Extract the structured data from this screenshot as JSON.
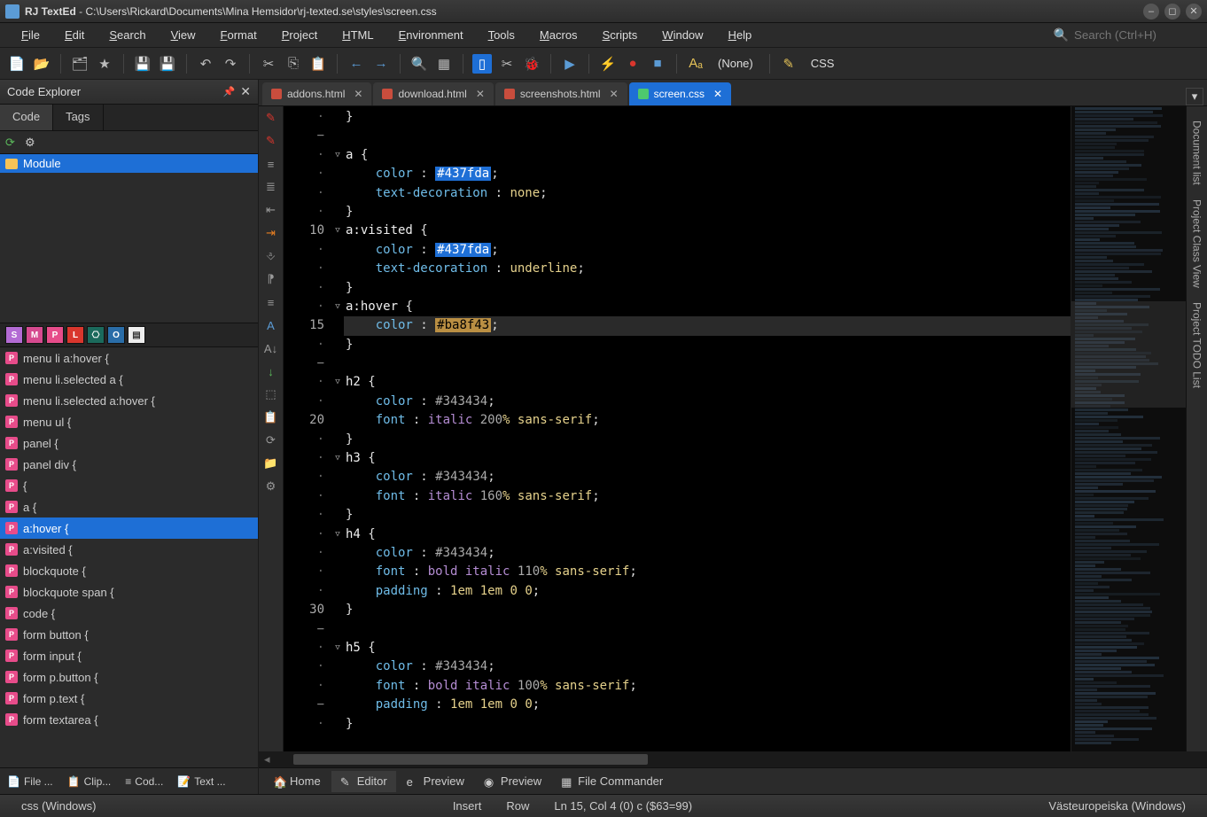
{
  "window": {
    "app_name": "RJ TextEd",
    "path": "C:\\Users\\Rickard\\Documents\\Mina Hemsidor\\rj-texted.se\\styles\\screen.css"
  },
  "menu": [
    "File",
    "Edit",
    "Search",
    "View",
    "Format",
    "Project",
    "HTML",
    "Environment",
    "Tools",
    "Macros",
    "Scripts",
    "Window",
    "Help"
  ],
  "search_placeholder": "Search (Ctrl+H)",
  "toolbar": {
    "scheme_label": "(None)",
    "lang_label": "CSS"
  },
  "explorer": {
    "title": "Code Explorer",
    "tabs": [
      "Code",
      "Tags"
    ],
    "active_tab": 0,
    "tree_item": "Module",
    "filters": [
      "S",
      "M",
      "P",
      "L",
      "⎔",
      "O",
      "▤"
    ],
    "list": [
      "menu li a:hover {",
      "menu li.selected a {",
      "menu li.selected a:hover {",
      "menu ul {",
      "panel {",
      "panel div {",
      "{",
      "a {",
      "a:hover {",
      "a:visited {",
      "blockquote {",
      "blockquote span {",
      "code {",
      "form button {",
      "form input {",
      "form p.button {",
      "form p.text {",
      "form textarea {"
    ],
    "selected_list": 8
  },
  "left_bottom_tabs": [
    "File ...",
    "Clip...",
    "Cod...",
    "Text ..."
  ],
  "doc_tabs": [
    {
      "label": "addons.html",
      "active": false
    },
    {
      "label": "download.html",
      "active": false
    },
    {
      "label": "screenshots.html",
      "active": false
    },
    {
      "label": "screen.css",
      "active": true
    }
  ],
  "code_lines": [
    {
      "g": "·",
      "f": "",
      "t": [
        [
          "brace",
          "}"
        ]
      ]
    },
    {
      "g": "−",
      "f": "",
      "t": []
    },
    {
      "g": "·",
      "f": "tri",
      "t": [
        [
          "sel",
          "a "
        ],
        [
          "brace",
          "{"
        ]
      ]
    },
    {
      "g": "·",
      "f": "",
      "t": [
        [
          "pad",
          "    "
        ],
        [
          "prop",
          "color"
        ],
        [
          "colon",
          " : "
        ],
        [
          "hex",
          "#437fda"
        ],
        [
          "semi",
          ";"
        ]
      ]
    },
    {
      "g": "·",
      "f": "",
      "t": [
        [
          "pad",
          "    "
        ],
        [
          "prop",
          "text-decoration"
        ],
        [
          "colon",
          " : "
        ],
        [
          "val",
          "none"
        ],
        [
          "semi",
          ";"
        ]
      ]
    },
    {
      "g": "·",
      "f": "",
      "t": [
        [
          "brace",
          "}"
        ]
      ]
    },
    {
      "g": "10",
      "f": "tri",
      "t": [
        [
          "sel",
          "a:visited "
        ],
        [
          "brace",
          "{"
        ]
      ]
    },
    {
      "g": "·",
      "f": "",
      "t": [
        [
          "pad",
          "    "
        ],
        [
          "prop",
          "color"
        ],
        [
          "colon",
          " : "
        ],
        [
          "hex",
          "#437fda"
        ],
        [
          "semi",
          ";"
        ]
      ]
    },
    {
      "g": "·",
      "f": "",
      "t": [
        [
          "pad",
          "    "
        ],
        [
          "prop",
          "text-decoration"
        ],
        [
          "colon",
          " : "
        ],
        [
          "val",
          "underline"
        ],
        [
          "semi",
          ";"
        ]
      ]
    },
    {
      "g": "·",
      "f": "",
      "t": [
        [
          "brace",
          "}"
        ]
      ]
    },
    {
      "g": "·",
      "f": "tri",
      "t": [
        [
          "sel",
          "a:hover "
        ],
        [
          "brace",
          "{"
        ]
      ]
    },
    {
      "g": "15",
      "f": "",
      "hl": true,
      "t": [
        [
          "pad",
          "    "
        ],
        [
          "prop",
          "color"
        ],
        [
          "colon",
          " : "
        ],
        [
          "hex2",
          "#ba8f43"
        ],
        [
          "semi",
          ";"
        ]
      ]
    },
    {
      "g": "·",
      "f": "",
      "t": [
        [
          "brace",
          "}"
        ]
      ]
    },
    {
      "g": "−",
      "f": "",
      "t": []
    },
    {
      "g": "·",
      "f": "tri",
      "t": [
        [
          "sel",
          "h2 "
        ],
        [
          "brace",
          "{"
        ]
      ]
    },
    {
      "g": "·",
      "f": "",
      "t": [
        [
          "pad",
          "    "
        ],
        [
          "prop",
          "color"
        ],
        [
          "colon",
          " : "
        ],
        [
          "gray",
          "#343434"
        ],
        [
          "semi",
          ";"
        ]
      ]
    },
    {
      "g": "20",
      "f": "",
      "t": [
        [
          "pad",
          "    "
        ],
        [
          "prop",
          "font"
        ],
        [
          "colon",
          " : "
        ],
        [
          "kw",
          "italic "
        ],
        [
          "gray",
          "200"
        ],
        [
          "val",
          "% sans-serif"
        ],
        [
          "semi",
          ";"
        ]
      ]
    },
    {
      "g": "·",
      "f": "",
      "t": [
        [
          "brace",
          "}"
        ]
      ]
    },
    {
      "g": "·",
      "f": "tri",
      "t": [
        [
          "sel",
          "h3 "
        ],
        [
          "brace",
          "{"
        ]
      ]
    },
    {
      "g": "·",
      "f": "",
      "t": [
        [
          "pad",
          "    "
        ],
        [
          "prop",
          "color"
        ],
        [
          "colon",
          " : "
        ],
        [
          "gray",
          "#343434"
        ],
        [
          "semi",
          ";"
        ]
      ]
    },
    {
      "g": "·",
      "f": "",
      "t": [
        [
          "pad",
          "    "
        ],
        [
          "prop",
          "font"
        ],
        [
          "colon",
          " : "
        ],
        [
          "kw",
          "italic "
        ],
        [
          "gray",
          "160"
        ],
        [
          "val",
          "% sans-serif"
        ],
        [
          "semi",
          ";"
        ]
      ]
    },
    {
      "g": "·",
      "f": "",
      "t": [
        [
          "brace",
          "}"
        ]
      ]
    },
    {
      "g": "·",
      "f": "tri",
      "t": [
        [
          "sel",
          "h4 "
        ],
        [
          "brace",
          "{"
        ]
      ]
    },
    {
      "g": "·",
      "f": "",
      "t": [
        [
          "pad",
          "    "
        ],
        [
          "prop",
          "color"
        ],
        [
          "colon",
          " : "
        ],
        [
          "gray",
          "#343434"
        ],
        [
          "semi",
          ";"
        ]
      ]
    },
    {
      "g": "·",
      "f": "",
      "t": [
        [
          "pad",
          "    "
        ],
        [
          "prop",
          "font"
        ],
        [
          "colon",
          " : "
        ],
        [
          "kw",
          "bold italic "
        ],
        [
          "gray",
          "110"
        ],
        [
          "val",
          "% sans-serif"
        ],
        [
          "semi",
          ";"
        ]
      ]
    },
    {
      "g": "·",
      "f": "",
      "t": [
        [
          "pad",
          "    "
        ],
        [
          "prop",
          "padding"
        ],
        [
          "colon",
          " : "
        ],
        [
          "val",
          "1em 1em 0 0"
        ],
        [
          "semi",
          ";"
        ]
      ]
    },
    {
      "g": "30",
      "f": "",
      "t": [
        [
          "brace",
          "}"
        ]
      ]
    },
    {
      "g": "−",
      "f": "",
      "t": []
    },
    {
      "g": "·",
      "f": "tri",
      "t": [
        [
          "sel",
          "h5 "
        ],
        [
          "brace",
          "{"
        ]
      ]
    },
    {
      "g": "·",
      "f": "",
      "t": [
        [
          "pad",
          "    "
        ],
        [
          "prop",
          "color"
        ],
        [
          "colon",
          " : "
        ],
        [
          "gray",
          "#343434"
        ],
        [
          "semi",
          ";"
        ]
      ]
    },
    {
      "g": "·",
      "f": "",
      "t": [
        [
          "pad",
          "    "
        ],
        [
          "prop",
          "font"
        ],
        [
          "colon",
          " : "
        ],
        [
          "kw",
          "bold italic "
        ],
        [
          "gray",
          "100"
        ],
        [
          "val",
          "% sans-serif"
        ],
        [
          "semi",
          ";"
        ]
      ]
    },
    {
      "g": "−",
      "f": "",
      "t": [
        [
          "pad",
          "    "
        ],
        [
          "prop",
          "padding"
        ],
        [
          "colon",
          " : "
        ],
        [
          "val",
          "1em 1em 0 0"
        ],
        [
          "semi",
          ";"
        ]
      ]
    },
    {
      "g": "·",
      "f": "",
      "t": [
        [
          "brace",
          "}"
        ]
      ]
    }
  ],
  "right_rail": [
    "Document list",
    "Project Class View",
    "Project TODO List"
  ],
  "bottom_tabs": [
    {
      "label": "Home",
      "icon": "🏠"
    },
    {
      "label": "Editor",
      "icon": "✎",
      "active": true
    },
    {
      "label": "Preview",
      "icon": "e"
    },
    {
      "label": "Preview",
      "icon": "◉"
    },
    {
      "label": "File Commander",
      "icon": "▦"
    }
  ],
  "status": {
    "left": "css (Windows)",
    "insert": "Insert",
    "row": "Row",
    "pos": "Ln 15, Col 4 (0) c ($63=99)",
    "encoding": "Västeuropeiska (Windows)"
  }
}
